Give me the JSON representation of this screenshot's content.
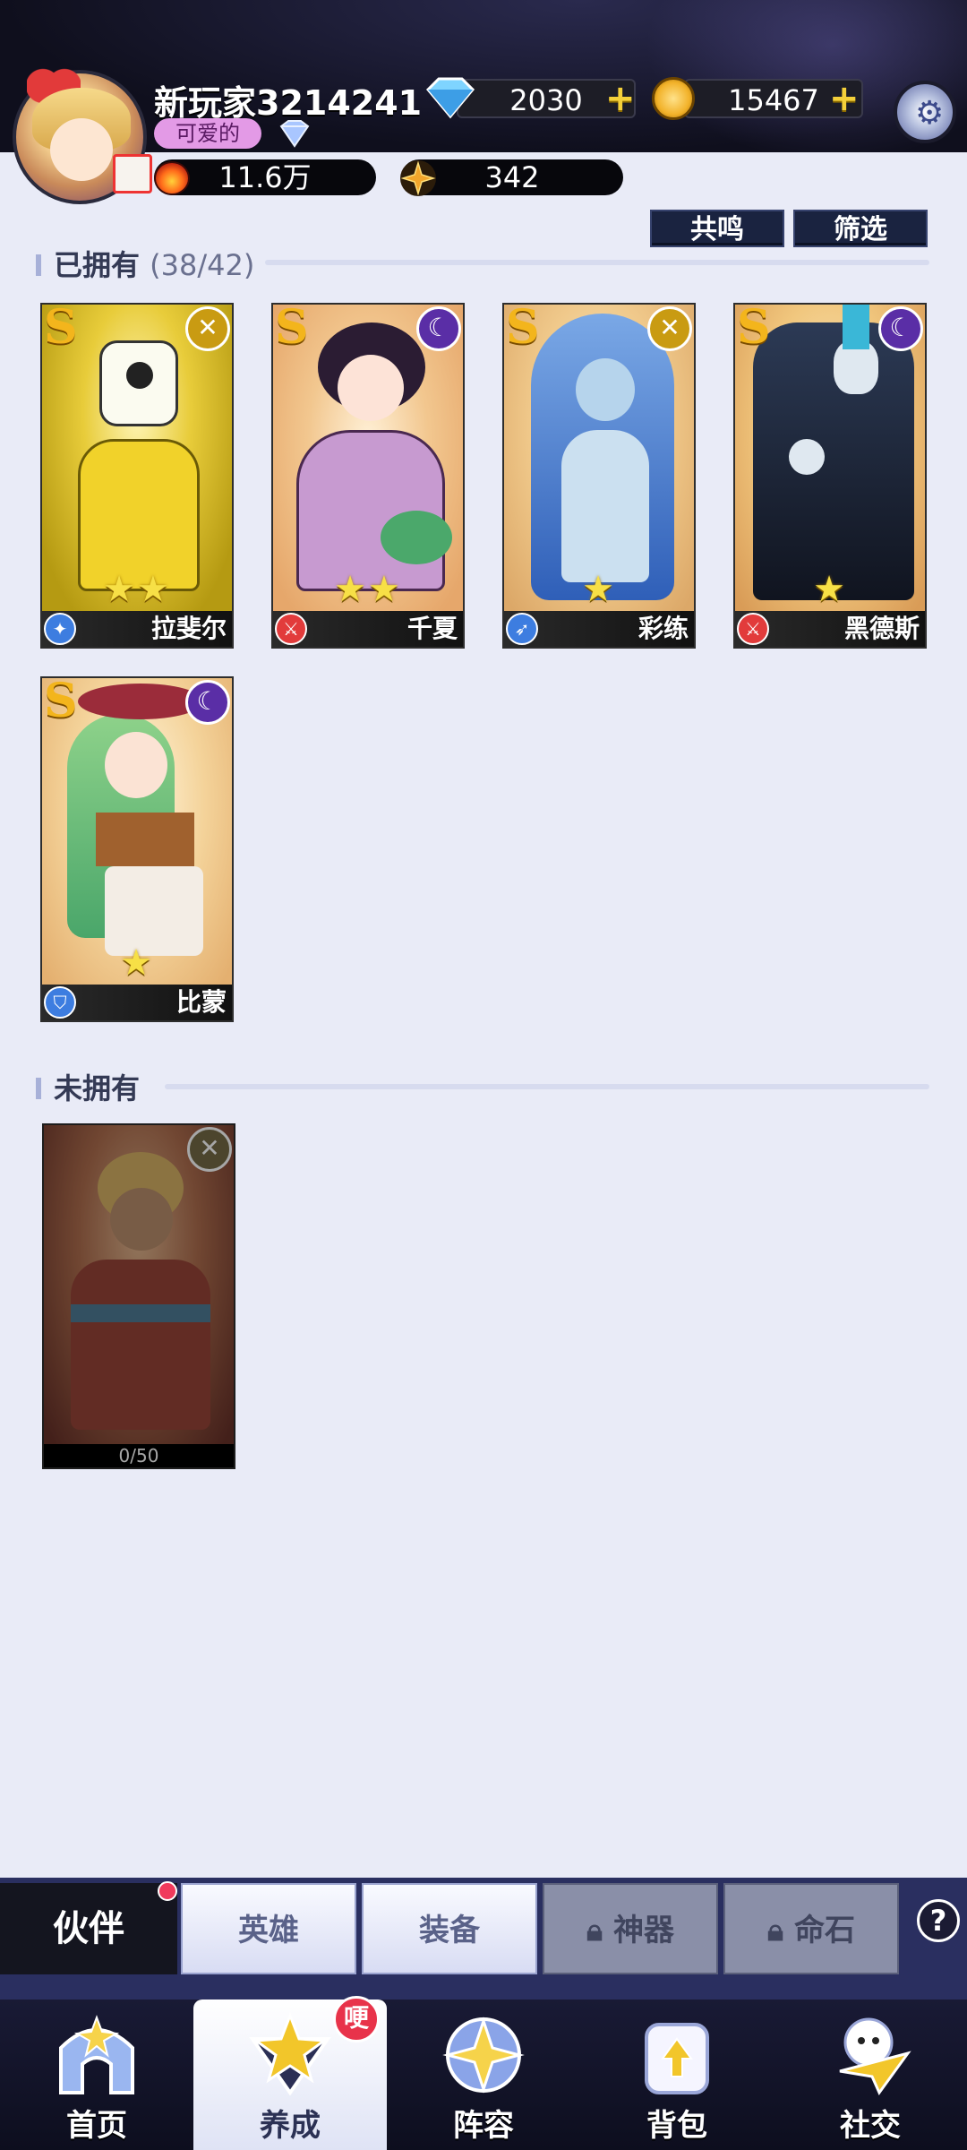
{
  "player": {
    "name": "新玩家3214241",
    "title": "可爱的",
    "power": "11.6万",
    "stars": "342"
  },
  "currency": {
    "diamonds": "2030",
    "gold": "15467"
  },
  "actions": {
    "resonance_label": "共鸣",
    "filter_label": "筛选"
  },
  "owned": {
    "header": "已拥有",
    "count": "(38/42)",
    "heroes": [
      {
        "name": "拉斐尔",
        "rank": "S",
        "stars": "★★",
        "element": "crossed-swords",
        "class": "mage"
      },
      {
        "name": "千夏",
        "rank": "S",
        "stars": "★★",
        "element": "moon",
        "class": "warrior"
      },
      {
        "name": "彩练",
        "rank": "S",
        "stars": "★",
        "element": "crossed-swords",
        "class": "archer"
      },
      {
        "name": "黑德斯",
        "rank": "S",
        "stars": "★",
        "element": "moon",
        "class": "warrior"
      },
      {
        "name": "比蒙",
        "rank": "S",
        "stars": "★",
        "element": "moon",
        "class": "tank"
      }
    ]
  },
  "not_owned": {
    "header": "未拥有",
    "heroes": [
      {
        "progress": "0/50",
        "element": "crossed-swords"
      }
    ]
  },
  "subtabs": {
    "partner": "伙伴",
    "hero": "英雄",
    "equipment": "装备",
    "artifact": "神器",
    "fate_stone": "命石",
    "help": "?"
  },
  "nav": {
    "home": "首页",
    "nurture": "养成",
    "nurture_badge": "哽",
    "lineup": "阵容",
    "backpack": "背包",
    "social": "社交"
  },
  "colors": {
    "accent_gold": "#f3b51c",
    "topbar_bg": "#0f0f1d",
    "page_bg": "#e9ebf7"
  }
}
